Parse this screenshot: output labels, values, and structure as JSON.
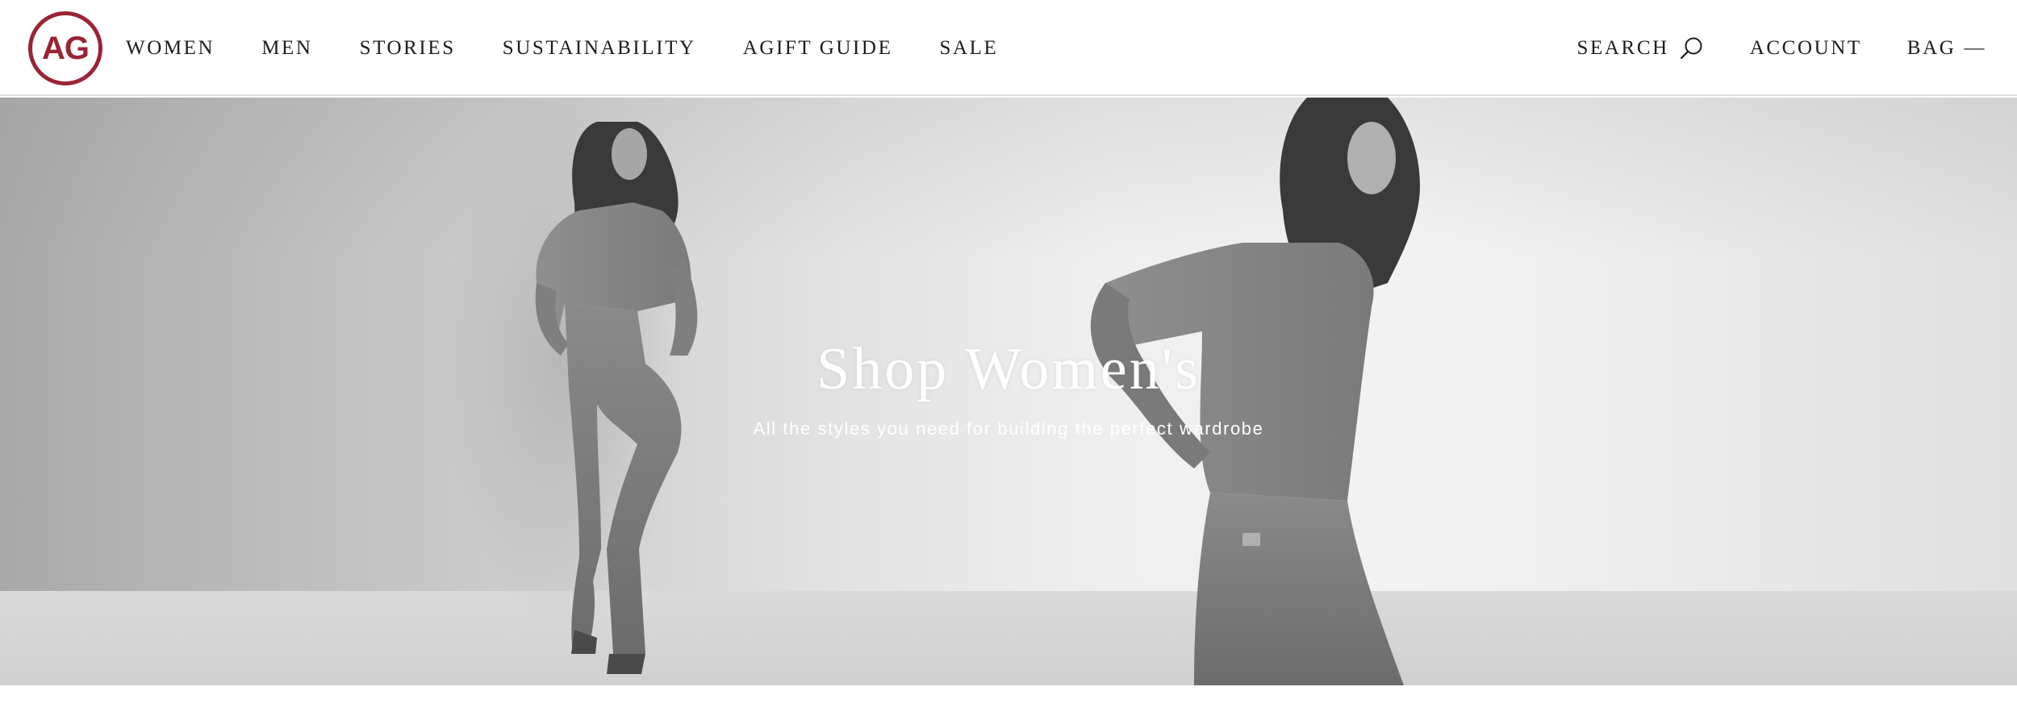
{
  "brand": {
    "logo_text": "AG",
    "accent": "#9b2335"
  },
  "nav": {
    "items": [
      "WOMEN",
      "MEN",
      "STORIES",
      "SUSTAINABILITY",
      "AGIFT GUIDE",
      "SALE"
    ]
  },
  "utility": {
    "search_label": "SEARCH",
    "search_icon": "search-icon",
    "account_label": "ACCOUNT",
    "bag_label": "BAG",
    "bag_count": "—"
  },
  "hero": {
    "title": "Shop Women's",
    "subtitle": "All the styles you need for building the perfect wardrobe",
    "image": "two models in sweaters and denim jeans, black and white photograph"
  }
}
